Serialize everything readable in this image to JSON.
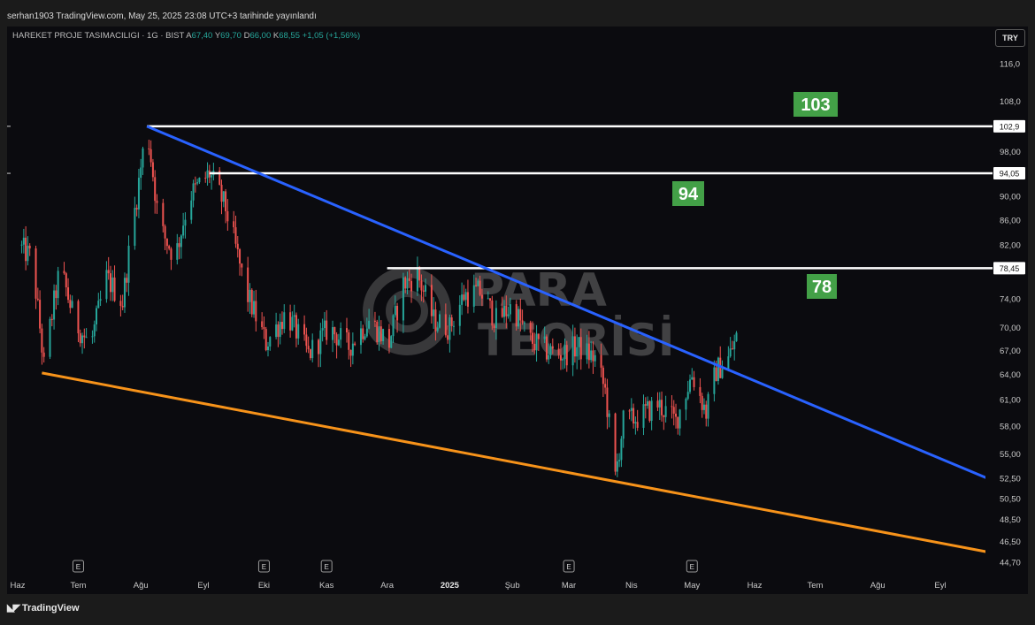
{
  "header": {
    "publisher_line": "serhan1903 TradingView.com, May 25, 2025 23:08 UTC+3 tarihinde yayınlandı"
  },
  "legend": {
    "symbol": "HAREKET PROJE TASIMACILIGI · 1G · BIST",
    "open_label": "A",
    "open": "67,40",
    "high_label": "Y",
    "high": "69,70",
    "low_label": "D",
    "low": "66,00",
    "close_label": "K",
    "close": "68,55",
    "change": "+1,05 (+1,56%)"
  },
  "currency_button": "TRY",
  "footer": {
    "brand": "TradingView"
  },
  "watermark": {
    "line1": "PARA",
    "line2": "TEORİSİ"
  },
  "colors": {
    "up": "#26a69a",
    "down": "#ef5350",
    "blue_trend": "#2962ff",
    "orange_trend": "#f7931a",
    "badge": "#43a047",
    "horizontal": "#ffffff"
  },
  "chart_data": {
    "type": "candlestick",
    "title": "",
    "y_scale": "log",
    "ylim": [
      44.0,
      120.0
    ],
    "y_ticks": [
      "116,0",
      "108,0",
      "98,00",
      "90,00",
      "86,00",
      "82,00",
      "74,00",
      "70,00",
      "67,00",
      "64,00",
      "61,00",
      "58,00",
      "55,00",
      "52,50",
      "50,50",
      "48,50",
      "46,50",
      "44,70"
    ],
    "x_labels": [
      "Haz",
      "Tem",
      "Ağu",
      "Eyl",
      "Eki",
      "Kas",
      "Ara",
      "2025",
      "Şub",
      "Mar",
      "Nis",
      "May",
      "Haz",
      "Tem",
      "Ağu",
      "Eyl"
    ],
    "x_label_dates": [
      "2024-06-01",
      "2024-07-01",
      "2024-08-01",
      "2024-09-01",
      "2024-10-01",
      "2024-11-01",
      "2024-12-01",
      "2025-01-01",
      "2025-02-01",
      "2025-03-01",
      "2025-04-01",
      "2025-05-01",
      "2025-06-01",
      "2025-07-01",
      "2025-08-01",
      "2025-09-01"
    ],
    "earnings_markers": {
      "label": "E",
      "dates": [
        "2024-07-01",
        "2024-10-01",
        "2024-11-01",
        "2025-03-01",
        "2025-05-01"
      ]
    },
    "price_path": [
      [
        "2024-06-01",
        82.0
      ],
      [
        "2024-06-08",
        80.0
      ],
      [
        "2024-06-14",
        65.0
      ],
      [
        "2024-06-22",
        78.5
      ],
      [
        "2024-06-29",
        71.0
      ],
      [
        "2024-07-07",
        67.5
      ],
      [
        "2024-07-15",
        77.0
      ],
      [
        "2024-07-23",
        73.5
      ],
      [
        "2024-07-30",
        90.0
      ],
      [
        "2024-08-04",
        102.9
      ],
      [
        "2024-08-10",
        85.0
      ],
      [
        "2024-08-18",
        80.0
      ],
      [
        "2024-08-25",
        90.0
      ],
      [
        "2024-09-04",
        94.05
      ],
      [
        "2024-09-12",
        88.0
      ],
      [
        "2024-09-22",
        75.0
      ],
      [
        "2024-10-02",
        68.0
      ],
      [
        "2024-10-12",
        72.0
      ],
      [
        "2024-10-23",
        66.5
      ],
      [
        "2024-11-02",
        70.0
      ],
      [
        "2024-11-12",
        67.5
      ],
      [
        "2024-11-22",
        71.0
      ],
      [
        "2024-12-02",
        68.0
      ],
      [
        "2024-12-09",
        76.0
      ],
      [
        "2024-12-16",
        77.5
      ],
      [
        "2024-12-24",
        71.0
      ],
      [
        "2025-01-01",
        70.0
      ],
      [
        "2025-01-08",
        74.5
      ],
      [
        "2025-01-16",
        75.0
      ],
      [
        "2025-01-24",
        71.0
      ],
      [
        "2025-02-01",
        73.0
      ],
      [
        "2025-02-09",
        68.5
      ],
      [
        "2025-02-18",
        67.0
      ],
      [
        "2025-02-26",
        66.5
      ],
      [
        "2025-03-05",
        67.5
      ],
      [
        "2025-03-14",
        66.0
      ],
      [
        "2025-03-19",
        62.0
      ],
      [
        "2025-03-24",
        52.5
      ],
      [
        "2025-03-28",
        58.5
      ],
      [
        "2025-04-05",
        59.0
      ],
      [
        "2025-04-14",
        60.5
      ],
      [
        "2025-04-23",
        58.5
      ],
      [
        "2025-05-01",
        64.0
      ],
      [
        "2025-05-08",
        59.5
      ],
      [
        "2025-05-13",
        64.5
      ],
      [
        "2025-05-19",
        66.0
      ],
      [
        "2025-05-23",
        68.55
      ]
    ],
    "horizontal_levels": [
      {
        "price": 102.9,
        "label": "102,9",
        "from": "2024-08-04"
      },
      {
        "price": 94.05,
        "label": "94,05",
        "from": "2024-09-04"
      },
      {
        "price": 78.45,
        "label": "78,45",
        "from": "2024-12-01"
      }
    ],
    "trendlines": [
      {
        "name": "upper",
        "color": "#2962ff",
        "from": [
          "2024-08-04",
          102.9
        ],
        "to": [
          "2025-09-30",
          52.0
        ]
      },
      {
        "name": "lower",
        "color": "#f7931a",
        "from": [
          "2024-06-13",
          64.2
        ],
        "to": [
          "2025-09-30",
          45.4
        ]
      }
    ],
    "target_badges": [
      "103",
      "94",
      "78"
    ]
  }
}
